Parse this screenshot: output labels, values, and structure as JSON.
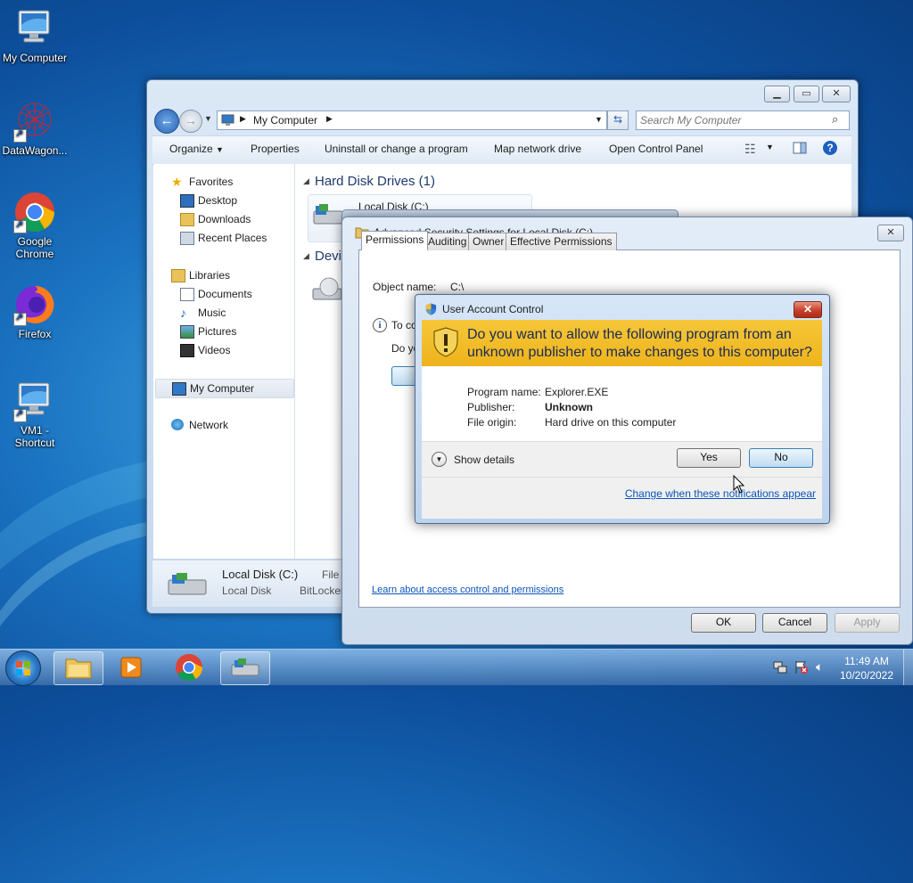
{
  "desktop": {
    "icons": [
      {
        "label": "My Computer"
      },
      {
        "label": "DataWagon..."
      },
      {
        "label": "Google Chrome"
      },
      {
        "label": "Firefox"
      },
      {
        "label": "VM1 - Shortcut"
      }
    ]
  },
  "explorer": {
    "address": {
      "location": "My Computer"
    },
    "search": {
      "placeholder": "Search My Computer"
    },
    "toolbar": {
      "organize": "Organize",
      "properties": "Properties",
      "uninstall": "Uninstall or change a program",
      "map_drive": "Map network drive",
      "control_panel": "Open Control Panel"
    },
    "nav": {
      "favorites": "Favorites",
      "desktop": "Desktop",
      "downloads": "Downloads",
      "recent": "Recent Places",
      "libraries": "Libraries",
      "documents": "Documents",
      "music": "Music",
      "pictures": "Pictures",
      "videos": "Videos",
      "my_computer": "My Computer",
      "network": "Network"
    },
    "content": {
      "hard_disk_header": "Hard Disk Drives (1)",
      "drive_label": "Local Disk (C:)",
      "devices_header": "Devi"
    },
    "details": {
      "name": "Local Disk (C:)",
      "type": "Local Disk",
      "file_col": "File",
      "bitlocker": "BitLocker"
    }
  },
  "adv_security": {
    "title": "Advanced Security Settings for Local Disk (C:)",
    "tabs": [
      "Permissions",
      "Auditing",
      "Owner",
      "Effective Permissions"
    ],
    "object_name_label": "Object name:",
    "object_name_value": "C:\\",
    "info_partial": "To co",
    "do_partial": "Do yo",
    "learn_link": "Learn about access control and permissions",
    "ok": "OK",
    "cancel": "Cancel",
    "apply": "Apply"
  },
  "uac": {
    "title": "User Account Control",
    "question": "Do you want to allow the following program from an unknown publisher to make changes to this computer?",
    "program_name_label": "Program name:",
    "program_name_value": "Explorer.EXE",
    "publisher_label": "Publisher:",
    "publisher_value": "Unknown",
    "file_origin_label": "File origin:",
    "file_origin_value": "Hard drive on this computer",
    "show_details": "Show details",
    "yes": "Yes",
    "no": "No",
    "change_link": "Change when these notifications appear"
  },
  "taskbar": {
    "time": "11:49 AM",
    "date": "10/20/2022"
  }
}
